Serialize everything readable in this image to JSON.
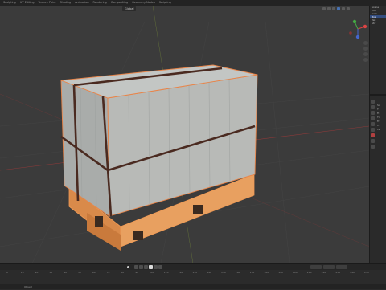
{
  "workspace_tabs": [
    "Sculpting",
    "UV Editing",
    "Texture Paint",
    "Shading",
    "Animation",
    "Rendering",
    "Compositing",
    "Geometry Nodes",
    "Scripting"
  ],
  "viewport": {
    "mode_label": "Global",
    "accent_color": "#4772b3",
    "selection_outline_color": "#e8854a"
  },
  "outliner": {
    "rows": [
      "Scene",
      "Coll",
      "Cam",
      "Box",
      "Pal",
      "Str"
    ]
  },
  "properties": {
    "lines": [
      "Sc",
      "T",
      "Fi",
      "Ti",
      "Fr",
      "Fr",
      "Fe"
    ]
  },
  "timeline": {
    "ticks": [
      "0",
      "10",
      "20",
      "30",
      "40",
      "50",
      "60",
      "70",
      "80",
      "90",
      "100",
      "110",
      "120",
      "130",
      "140",
      "150",
      "160",
      "170",
      "180",
      "190",
      "200",
      "210",
      "220",
      "230",
      "240",
      "250"
    ]
  },
  "statusbar": {
    "text": "Object"
  }
}
